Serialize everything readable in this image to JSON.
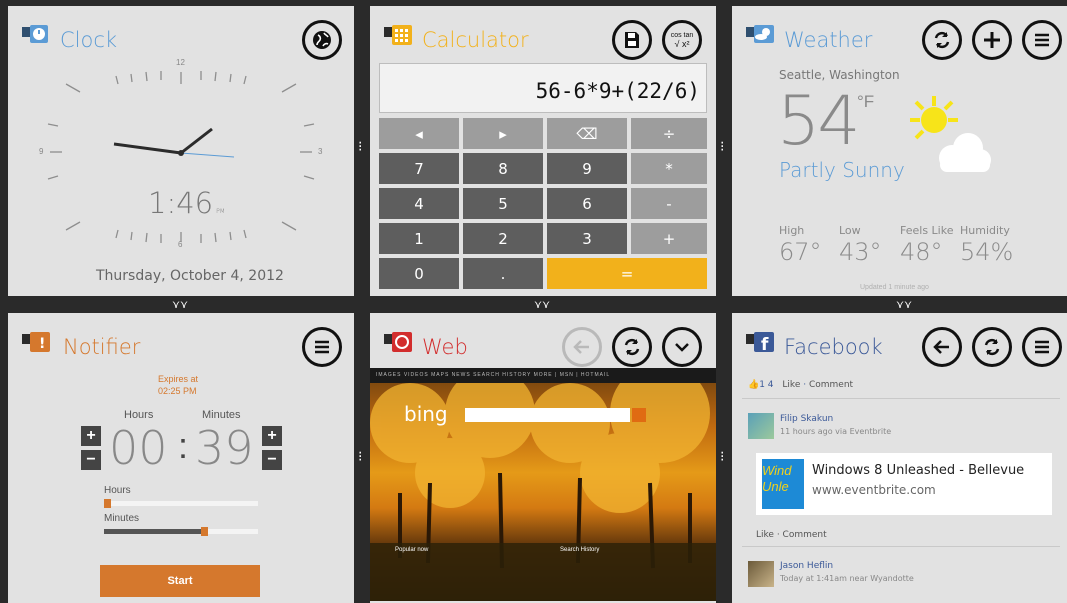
{
  "clock": {
    "title": "Clock",
    "time": "1:46",
    "ampm": "PM",
    "date": "Thursday, October 4, 2012",
    "dial": {
      "n12": "12",
      "n3": "3",
      "n6": "6",
      "n9": "9"
    },
    "accent": "#5b9bd5"
  },
  "calculator": {
    "title": "Calculator",
    "display": "56-6*9+(22/6)",
    "trig_label_top": "cos tan",
    "trig_label_bottom": "√ x²",
    "keys": {
      "left": "◂",
      "right": "▸",
      "back": "⌫",
      "div": "÷",
      "k7": "7",
      "k8": "8",
      "k9": "9",
      "mul": "*",
      "k4": "4",
      "k5": "5",
      "k6": "6",
      "sub": "-",
      "k1": "1",
      "k2": "2",
      "k3": "3",
      "add": "+",
      "k0": "0",
      "dot": ".",
      "eq": "="
    },
    "accent": "#f2b11b"
  },
  "weather": {
    "title": "Weather",
    "location": "Seattle, Washington",
    "temp": "54",
    "unit": "°F",
    "condition": "Partly Sunny",
    "high_label": "High",
    "high": "67°",
    "low_label": "Low",
    "low": "43°",
    "feels_label": "Feels Like",
    "feels": "48°",
    "humidity_label": "Humidity",
    "humidity": "54%",
    "updated": "Updated 1 minute ago",
    "accent": "#5b9bd5"
  },
  "notifier": {
    "title": "Notifier",
    "expires_line1": "Expires at",
    "expires_line2": "02:25 PM",
    "hours_col": "Hours",
    "minutes_col": "Minutes",
    "hours_value": "00",
    "minutes_value": "39",
    "slider_hours_label": "Hours",
    "slider_minutes_label": "Minutes",
    "slider_hours_fraction": 0,
    "slider_minutes_fraction": 0.65,
    "start_label": "Start",
    "accent": "#d5782d"
  },
  "web": {
    "title": "Web",
    "nav": "IMAGES   VIDEOS   MAPS   NEWS   SEARCH HISTORY   MORE  |  MSN  |  HOTMAIL",
    "logo": "bing",
    "popular_now": "Popular now",
    "search_history": "Search History",
    "accent": "#d22d2d"
  },
  "facebook": {
    "title": "Facebook",
    "counts": "1  4",
    "like": "Like",
    "comment": "Comment",
    "post1_author": "Filip Skakun",
    "post1_meta": "11 hours ago via Eventbrite",
    "link_title": "Windows 8 Unleashed - Bellevue",
    "link_url": "www.eventbrite.com",
    "link_thumb": "Wind Unle",
    "post2_author": "Jason Heflin",
    "post2_meta": "Today at 1:41am near Wyandotte",
    "accent": "#3b5998"
  },
  "grips": {
    "h": "⋎⋎",
    "v": "⁝"
  }
}
